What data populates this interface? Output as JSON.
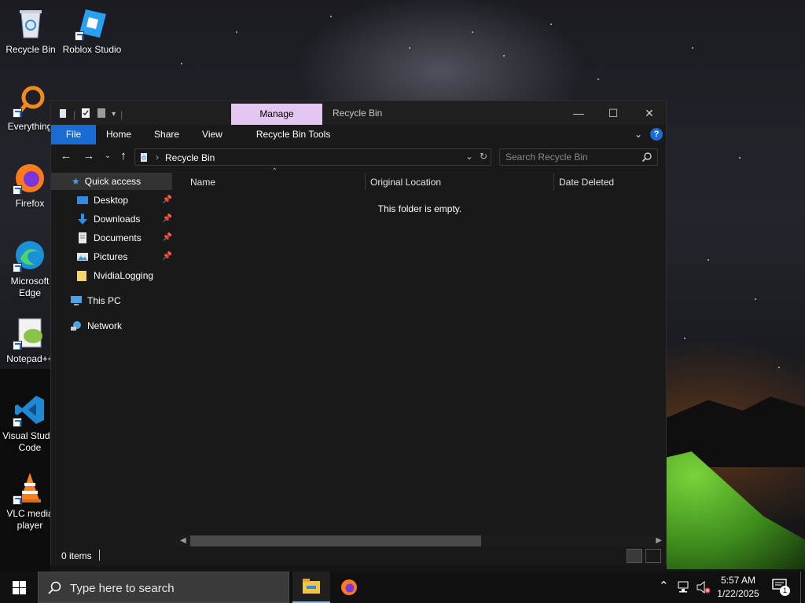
{
  "desktop": {
    "icons": [
      {
        "label": "Recycle Bin"
      },
      {
        "label": "Roblox Studio"
      },
      {
        "label": "Everything"
      },
      {
        "label": "Firefox"
      },
      {
        "label": "Microsoft Edge"
      },
      {
        "label": "Notepad++"
      },
      {
        "label": "Visual Studio Code"
      },
      {
        "label": "VLC media player"
      }
    ]
  },
  "explorer": {
    "title": "Recycle Bin",
    "contextual_tab": "Manage",
    "ribbon_tabs": [
      "File",
      "Home",
      "Share",
      "View",
      "Recycle Bin Tools"
    ],
    "address": {
      "path": "Recycle Bin"
    },
    "search": {
      "placeholder": "Search Recycle Bin"
    },
    "nav_pane": {
      "quick_access": "Quick access",
      "pinned": [
        "Desktop",
        "Downloads",
        "Documents",
        "Pictures"
      ],
      "other": "NvidiaLogging",
      "this_pc": "This PC",
      "network": "Network"
    },
    "columns": [
      "Name",
      "Original Location",
      "Date Deleted"
    ],
    "empty_message": "This folder is empty.",
    "status": "0 items"
  },
  "taskbar": {
    "search_placeholder": "Type here to search",
    "time": "5:57 AM",
    "date": "1/22/2025",
    "notification_count": "1"
  },
  "colors": {
    "accent": "#1a6bd2",
    "manage_tab": "#e4c7f0",
    "window_bg": "#191919"
  }
}
